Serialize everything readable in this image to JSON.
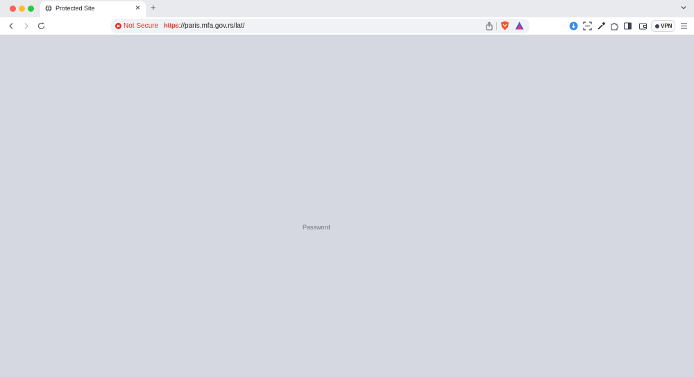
{
  "window": {
    "controls": [
      "close",
      "minimize",
      "maximize"
    ]
  },
  "tabs": [
    {
      "title": "Protected Site",
      "icon": "globe-icon",
      "active": true
    }
  ],
  "tab_actions": {
    "close_symbol": "×",
    "new_tab_symbol": "+",
    "tab_search_icon": "chevron-down-icon"
  },
  "toolbar": {
    "back_icon": "chevron-left-icon",
    "forward_icon": "chevron-right-icon",
    "reload_icon": "reload-icon",
    "security_label": "Not Secure",
    "url_scheme": "https",
    "url_rest": "://paris.mfa.gov.rs/lat/",
    "share_icon": "share-icon",
    "shields_icon": "brave-shields-icon",
    "rewards_icon": "brave-rewards-icon",
    "extensions": [
      "puzzle-extension-icon",
      "screenshot-icon",
      "eyedropper-icon",
      "extensions-icon",
      "sidebar-icon",
      "wallet-icon"
    ],
    "vpn_label": "VPN",
    "menu_icon": "hamburger-menu-icon"
  },
  "page": {
    "password_label": "Password"
  },
  "colors": {
    "page_background": "#d5d8e0",
    "not_secure_red": "#d93025",
    "shields_orange": "#fb542b",
    "rewards_blue": "#4c54d2",
    "extension_blue": "#3b8ee8"
  }
}
